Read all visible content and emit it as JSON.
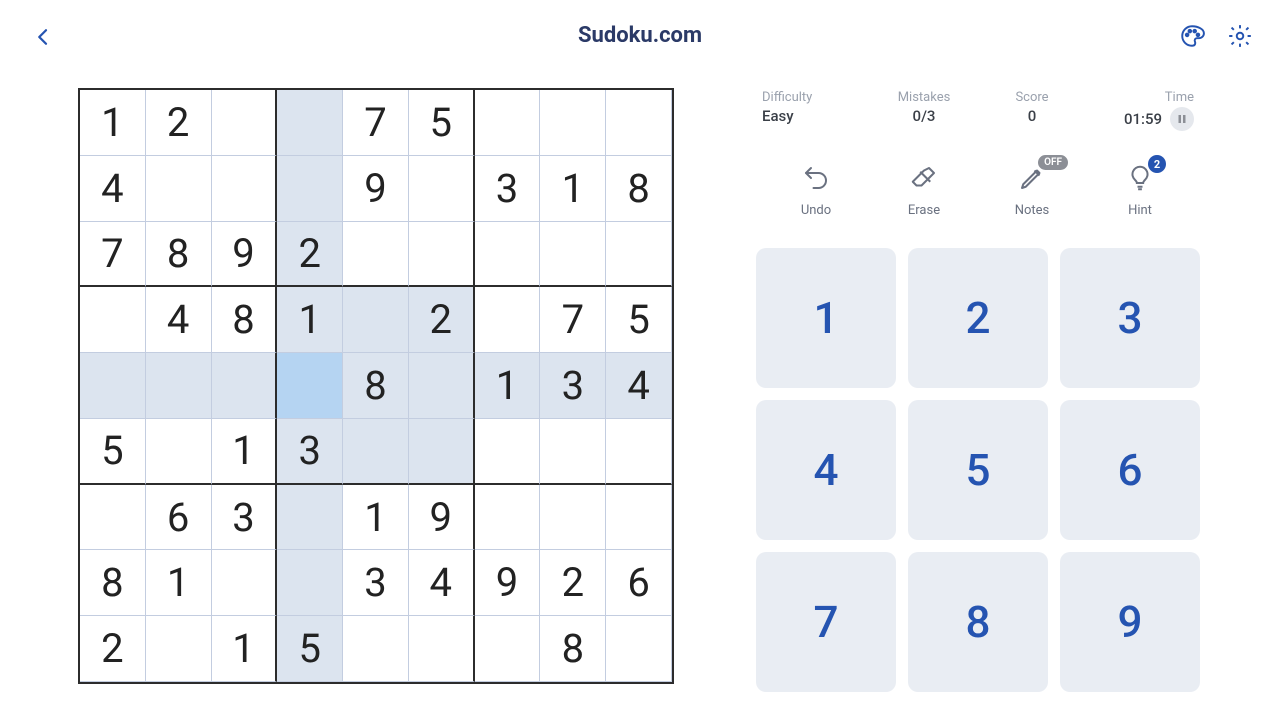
{
  "header": {
    "title": "Sudoku.com"
  },
  "stats": {
    "difficulty_label": "Difficulty",
    "difficulty_value": "Easy",
    "mistakes_label": "Mistakes",
    "mistakes_value": "0/3",
    "score_label": "Score",
    "score_value": "0",
    "time_label": "Time",
    "time_value": "01:59"
  },
  "actions": {
    "undo": "Undo",
    "erase": "Erase",
    "notes": "Notes",
    "notes_badge": "OFF",
    "hint": "Hint",
    "hint_badge": "2"
  },
  "numpad": [
    "1",
    "2",
    "3",
    "4",
    "5",
    "6",
    "7",
    "8",
    "9"
  ],
  "board": [
    [
      "1",
      "2",
      "",
      "",
      "7",
      "5",
      "",
      "",
      ""
    ],
    [
      "4",
      "",
      "",
      "",
      "9",
      "",
      "3",
      "1",
      "8"
    ],
    [
      "7",
      "8",
      "9",
      "2",
      "",
      "",
      "",
      "",
      ""
    ],
    [
      "",
      "4",
      "8",
      "1",
      "",
      "2",
      "",
      "7",
      "5"
    ],
    [
      "",
      "",
      "",
      "",
      "8",
      "",
      "1",
      "3",
      "4"
    ],
    [
      "5",
      "",
      "1",
      "3",
      "",
      "",
      "",
      "",
      ""
    ],
    [
      "",
      "6",
      "3",
      "",
      "1",
      "9",
      "",
      "",
      ""
    ],
    [
      "8",
      "1",
      "",
      "",
      "3",
      "4",
      "9",
      "2",
      "6"
    ],
    [
      "2",
      "",
      "1",
      "5",
      "",
      "",
      "",
      "8",
      ""
    ]
  ],
  "selected": {
    "row": 4,
    "col": 3
  }
}
